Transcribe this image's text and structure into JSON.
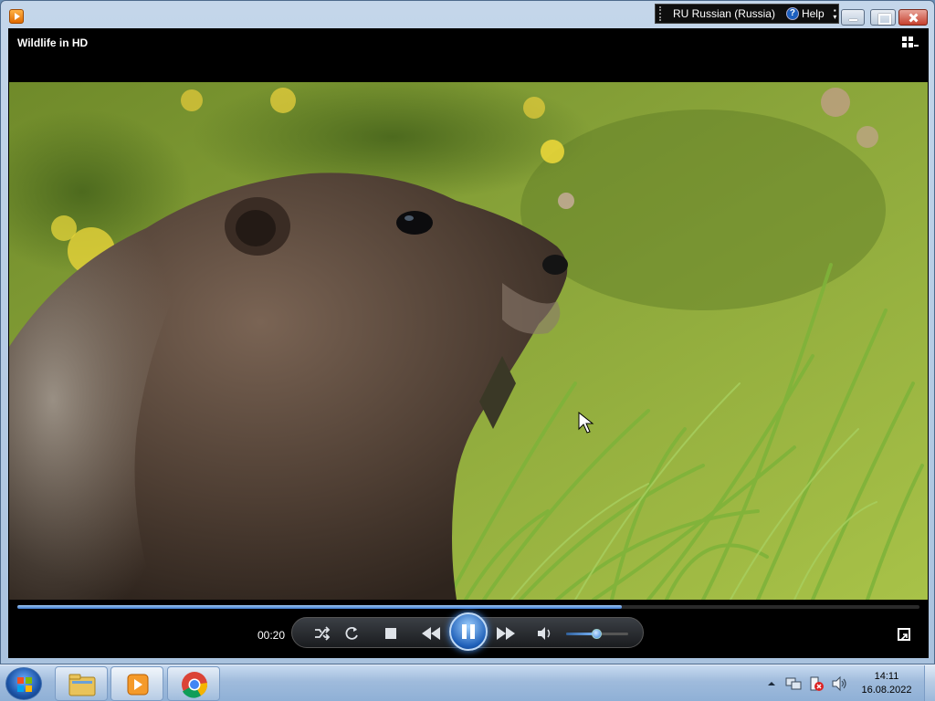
{
  "window": {
    "app_icon": "windows-media-player-icon"
  },
  "language_bar": {
    "language": "RU Russian (Russia)",
    "help_label": "Help",
    "help_icon": "question-mark-icon"
  },
  "player": {
    "title": "Wildlife in HD",
    "elapsed_time": "00:20",
    "progress": 0.67,
    "volume": 0.48,
    "state": "playing",
    "video_description_icon": "video-frame-marmot"
  },
  "taskbar": {
    "items": [
      {
        "icon": "windows-explorer-icon"
      },
      {
        "icon": "windows-media-player-icon",
        "active": true
      },
      {
        "icon": "google-chrome-icon"
      }
    ],
    "tray_icons": [
      "show-hidden-icons-chevron",
      "network-icon",
      "action-center-icon",
      "volume-icon"
    ],
    "clock_time": "14:11",
    "clock_date": "16.08.2022"
  },
  "colors": {
    "taskbar": "#9fbbdc",
    "window_frame": "#b6cbe3",
    "player_background": "#000000",
    "accent": "#3d7ad0"
  }
}
